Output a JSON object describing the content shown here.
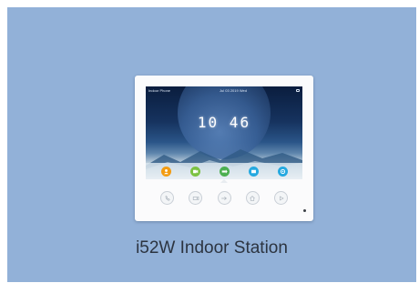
{
  "product": {
    "name": "i52W Indoor Station"
  },
  "screen": {
    "status_left": "Indoor Phone",
    "status_center": "Jul 03 2019 Wed",
    "clock": "10 46"
  },
  "dock": [
    {
      "icon": "contacts-icon",
      "color": "#f39c12"
    },
    {
      "icon": "monitor-icon",
      "color": "#7cc242"
    },
    {
      "icon": "unlock-icon",
      "color": "#4caf50"
    },
    {
      "icon": "message-icon",
      "color": "#26a9e0"
    },
    {
      "icon": "settings-icon",
      "color": "#26a9e0"
    }
  ],
  "hardware_buttons": [
    {
      "icon": "call-icon"
    },
    {
      "icon": "monitor-icon"
    },
    {
      "icon": "unlock-icon"
    },
    {
      "icon": "home-icon"
    },
    {
      "icon": "talk-icon"
    }
  ],
  "colors": {
    "background": "#92b1d8",
    "device_body": "#fbfbfc",
    "caption_text": "#2c3440"
  }
}
